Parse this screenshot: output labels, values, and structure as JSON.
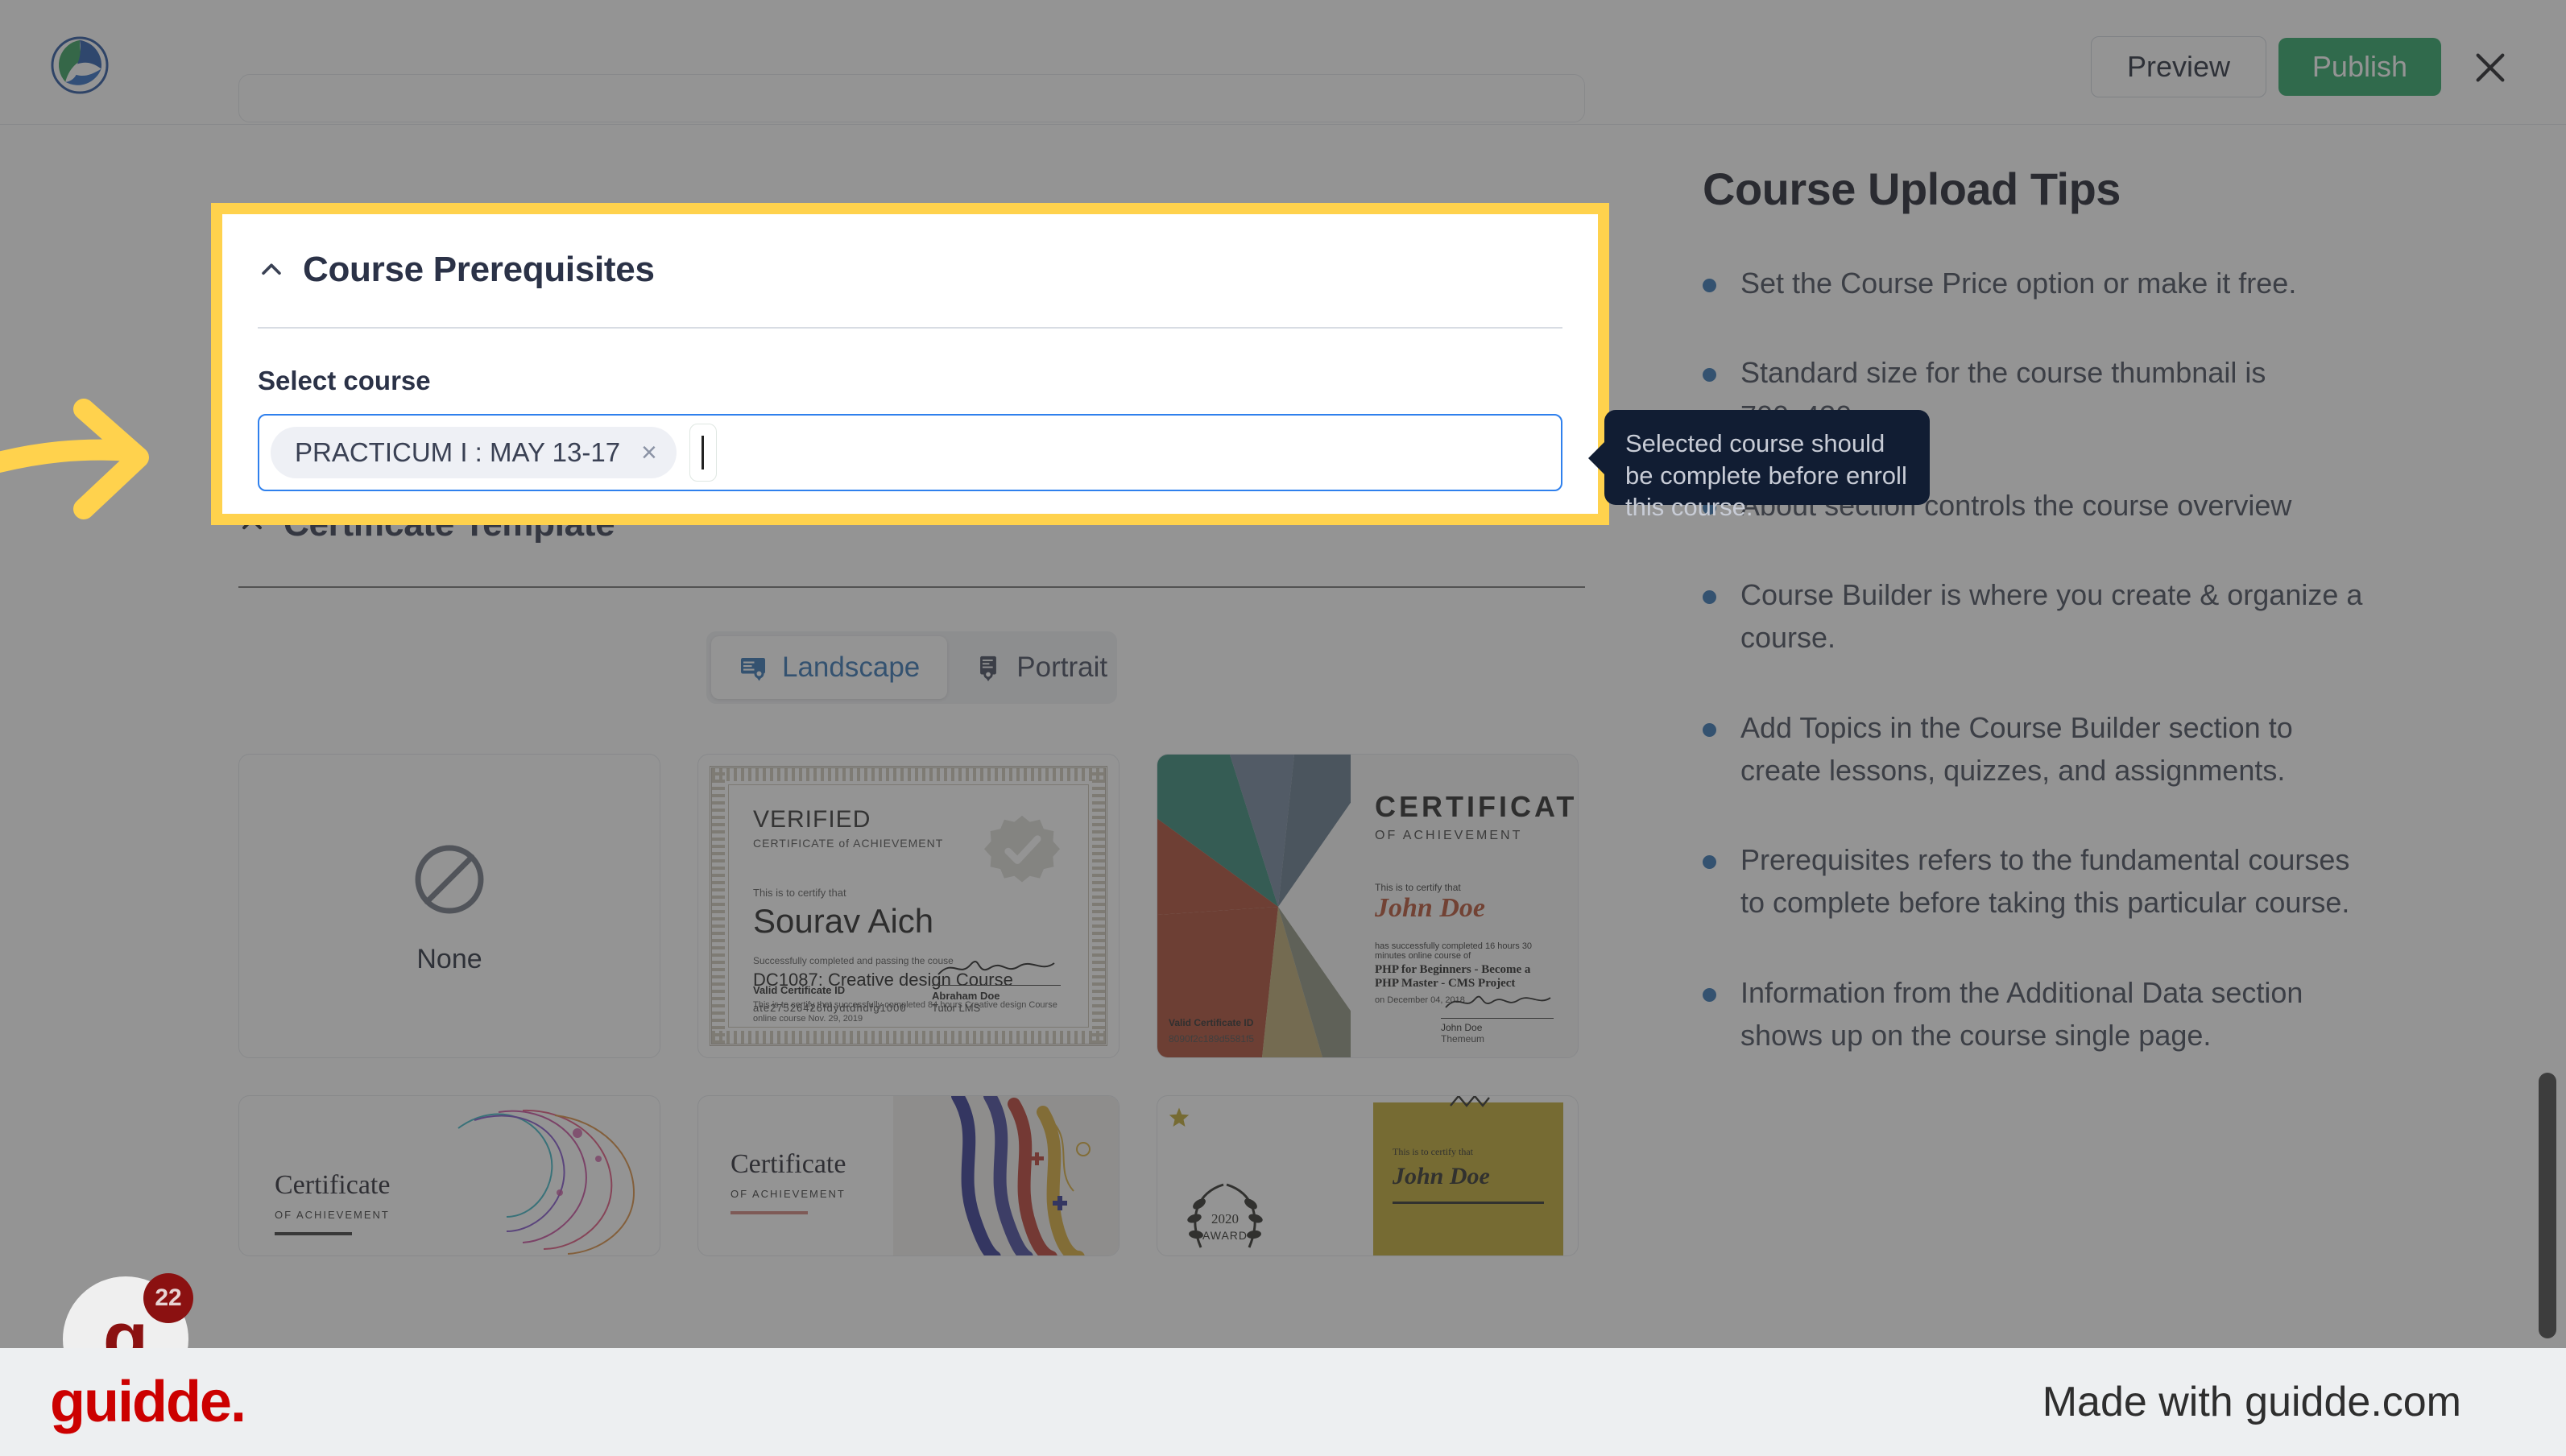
{
  "topbar": {
    "logo_icon": "app-logo-circle",
    "preview_label": "Preview",
    "publish_label": "Publish",
    "close_icon": "close-icon",
    "publish_color": "#23a35f"
  },
  "prerequisites": {
    "chevron_icon": "chevron-up-icon",
    "title": "Course Prerequisites",
    "field_label": "Select course",
    "chip": {
      "label": "PRACTICUM I : MAY 13-17",
      "remove_icon": "×"
    },
    "highlight_color": "#ffd24d",
    "focus_border_color": "#2f80ed"
  },
  "tooltip": {
    "text": "Selected course should be complete before enroll this course.",
    "bg_color": "#111d33"
  },
  "certificate_template": {
    "chevron_icon": "chevron-up-icon",
    "title": "Certificate Template",
    "orientation": {
      "landscape_label": "Landscape",
      "landscape_icon": "certificate-landscape-icon",
      "portrait_label": "Portrait",
      "portrait_icon": "certificate-portrait-icon",
      "selected": "Landscape"
    },
    "cards": {
      "none": {
        "label": "None",
        "icon": "slashed-circle-icon"
      },
      "verified": {
        "heading": "VERIFIED",
        "subheading": "CERTIFICATE of ACHIEVEMENT",
        "certify_line": "This is to certify that",
        "name": "Sourav Aich",
        "passing_line": "Successfully completed and passing the couse",
        "course": "DC1087: Creative design Course",
        "description": "This is to certify that successfully completed 84 hours Creative design Course online  course Nov. 29, 2019",
        "id_label": "Valid Certificate ID",
        "id_value": "ate27526426fdydtdhdfg1000",
        "signer": "Abraham Doe",
        "organization": "Tutor LMS",
        "badge_icon": "verified-seal-icon"
      },
      "colorful": {
        "heading": "CERTIFICATE",
        "subheading": "OF ACHIEVEMENT",
        "certify_line": "This is to certify that",
        "name": "John Doe",
        "completed_line": "has successfully completed 16 hours 30 minutes online course of",
        "course": "PHP for Beginners - Become a PHP Master - CMS Project",
        "date_line": "on December 04, 2018",
        "id_label": "Valid Certificate ID",
        "id_value": "8090f2c189d5581f5",
        "signer": "John Doe",
        "organization": "Themeum"
      },
      "row2": [
        {
          "title": "Certificate",
          "subtitle": "OF ACHIEVEMENT",
          "art": "paisley-swirl"
        },
        {
          "title": "Certificate",
          "subtitle": "OF ACHIEVEMENT",
          "art": "abstract-stripes"
        },
        {
          "title": "",
          "subtitle": "",
          "art": "laurel-award-2020",
          "certify_line": "This is to certify that",
          "name": "John Doe",
          "award_year": "2020",
          "award_label": "AWARD"
        }
      ]
    }
  },
  "tips": {
    "title": "Course Upload Tips",
    "items": [
      "Set the Course Price option or make it free.",
      "Standard size for the course thumbnail is 700x430.",
      "About section controls the course overview",
      "Course Builder is where you create & organize a course.",
      "Add Topics in the Course Builder section to create lessons, quizzes, and assignments.",
      "Prerequisites refers to the fundamental courses to complete before taking this particular course.",
      "Information from the Additional Data section shows up on the course single page."
    ],
    "bullet_color": "#2a6db0"
  },
  "annotation": {
    "arrow_icon": "curved-right-arrow",
    "arrow_color": "#ffd24d"
  },
  "badge": {
    "letter": "g",
    "count": "22"
  },
  "footer": {
    "logo_text": "guidde.",
    "made_with": "Made with guidde.com",
    "logo_color": "#cc0000"
  }
}
